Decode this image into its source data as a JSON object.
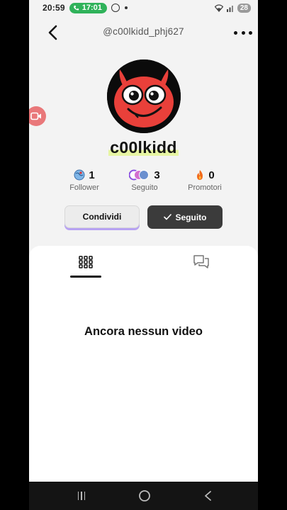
{
  "status_bar": {
    "time": "20:59",
    "call_time": "17:01",
    "battery": "28",
    "icons": [
      "call-icon",
      "whatsapp-icon",
      "dot-icon",
      "wifi-icon",
      "signal-icon",
      "battery-icon"
    ]
  },
  "header": {
    "username": "@c00lkidd_phj627",
    "back_icon": "chevron-left-icon",
    "more_icon": "ellipsis-icon"
  },
  "profile": {
    "display_name": "c00lkidd",
    "avatar_icon": "red-devil-avatar"
  },
  "stats": [
    {
      "value": "1",
      "label": "Follower",
      "icon": "globe-avatar-icon"
    },
    {
      "value": "3",
      "label": "Seguito",
      "icon": "stacked-avatars-icon"
    },
    {
      "value": "0",
      "label": "Promotori",
      "icon": "fire-icon"
    }
  ],
  "actions": {
    "share_label": "Condividi",
    "following_label": "Seguito"
  },
  "tabs": {
    "videos_icon": "grid-icon",
    "comments_icon": "chat-bubbles-icon"
  },
  "empty_state": {
    "message": "Ancora nessun video"
  },
  "colors": {
    "accent_purple": "#b7a2f2",
    "call_green": "#2fb25a",
    "avatar_red": "#e9403a",
    "dark_button": "#3b3b3b"
  }
}
